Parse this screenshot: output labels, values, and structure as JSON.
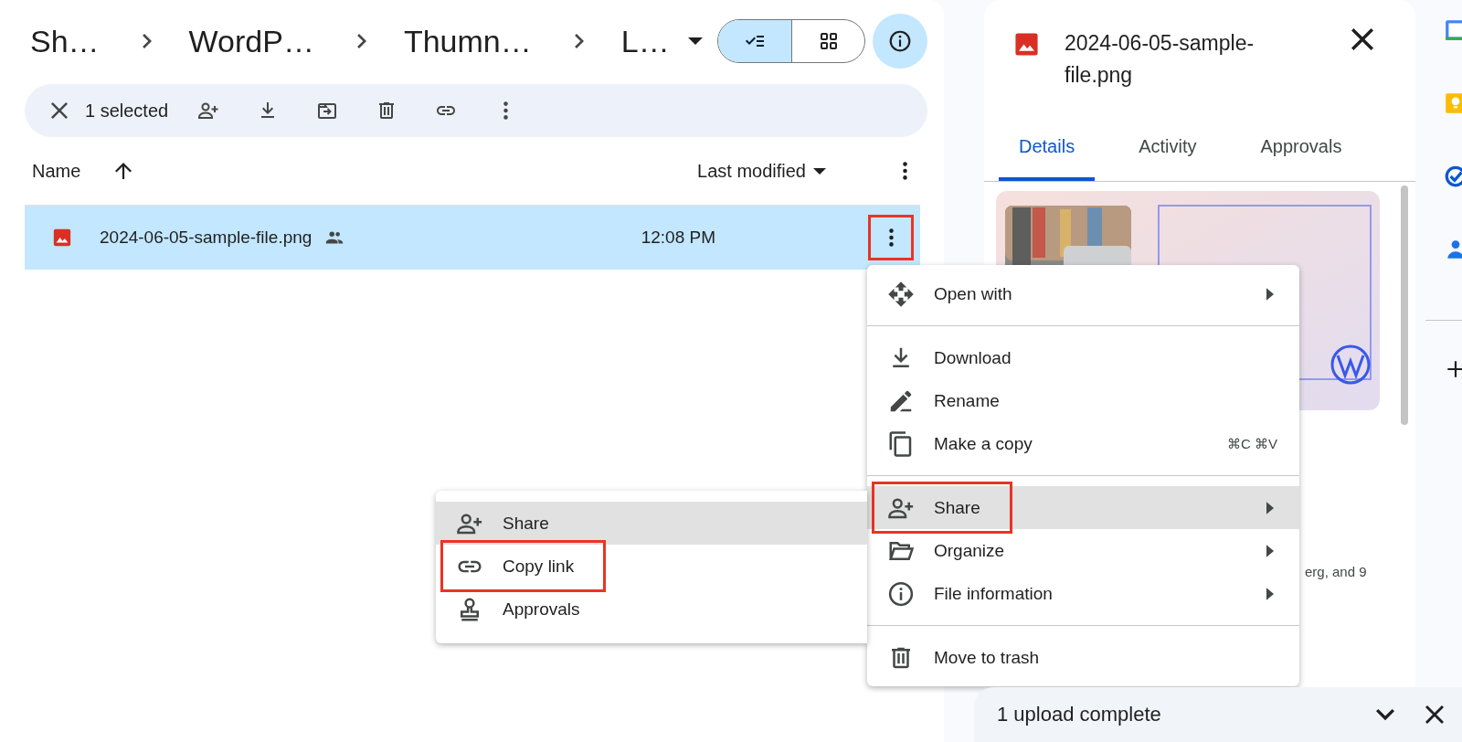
{
  "breadcrumbs": [
    {
      "label": "Sh…"
    },
    {
      "label": "WordP…"
    },
    {
      "label": "Thumn…"
    },
    {
      "label": "L…",
      "dropdown": true
    }
  ],
  "view_toggle": [
    {
      "kind": "list",
      "selected": true
    },
    {
      "kind": "grid",
      "selected": false
    }
  ],
  "info_button": {
    "selected": true
  },
  "selection_bar": {
    "count": "1 selected",
    "actions": [
      {
        "kind": "share"
      },
      {
        "kind": "download"
      },
      {
        "kind": "move"
      },
      {
        "kind": "trash"
      },
      {
        "kind": "link"
      },
      {
        "kind": "more"
      }
    ]
  },
  "table": {
    "columns": [
      {
        "label": "Name"
      },
      {
        "label": "Last modified"
      }
    ],
    "rows": [
      {
        "name": "2024-06-05-sample-file.png",
        "shared": true,
        "modified": "12:08 PM",
        "selected": true,
        "menu_highlighted": true
      }
    ]
  },
  "context_menu": {
    "groups": [
      [
        {
          "kind": "open-with",
          "label": "Open with",
          "submenu": true,
          "selected": false,
          "highlighted": false
        }
      ],
      [
        {
          "kind": "download",
          "label": "Download",
          "submenu": false,
          "selected": false,
          "highlighted": false
        },
        {
          "kind": "rename",
          "label": "Rename",
          "submenu": false,
          "selected": false,
          "highlighted": false
        },
        {
          "kind": "copy",
          "label": "Make a copy",
          "shortcut": "⌘C ⌘V",
          "submenu": false,
          "selected": false,
          "highlighted": false
        }
      ],
      [
        {
          "kind": "share",
          "label": "Share",
          "submenu": true,
          "selected": true,
          "highlighted": true
        },
        {
          "kind": "organize",
          "label": "Organize",
          "submenu": true,
          "selected": false,
          "highlighted": false
        },
        {
          "kind": "info",
          "label": "File information",
          "submenu": true,
          "selected": false,
          "highlighted": false
        }
      ],
      [
        {
          "kind": "trash",
          "label": "Move to trash",
          "submenu": false,
          "selected": false,
          "highlighted": false
        }
      ]
    ]
  },
  "share_submenu": {
    "items": [
      {
        "kind": "share",
        "label": "Share",
        "selected": true,
        "highlighted": false
      },
      {
        "kind": "link",
        "label": "Copy link",
        "selected": false,
        "highlighted": true
      },
      {
        "kind": "approvals",
        "label": "Approvals",
        "selected": false,
        "highlighted": false
      }
    ]
  },
  "details_panel": {
    "title": "2024-06-05-sample-file.png",
    "tabs": [
      {
        "label": "Details",
        "selected": true
      },
      {
        "label": "Activity",
        "selected": false
      },
      {
        "label": "Approvals",
        "selected": false
      }
    ],
    "partial_text": "erg, and 9"
  },
  "upload_toast": {
    "message": "1 upload complete"
  }
}
